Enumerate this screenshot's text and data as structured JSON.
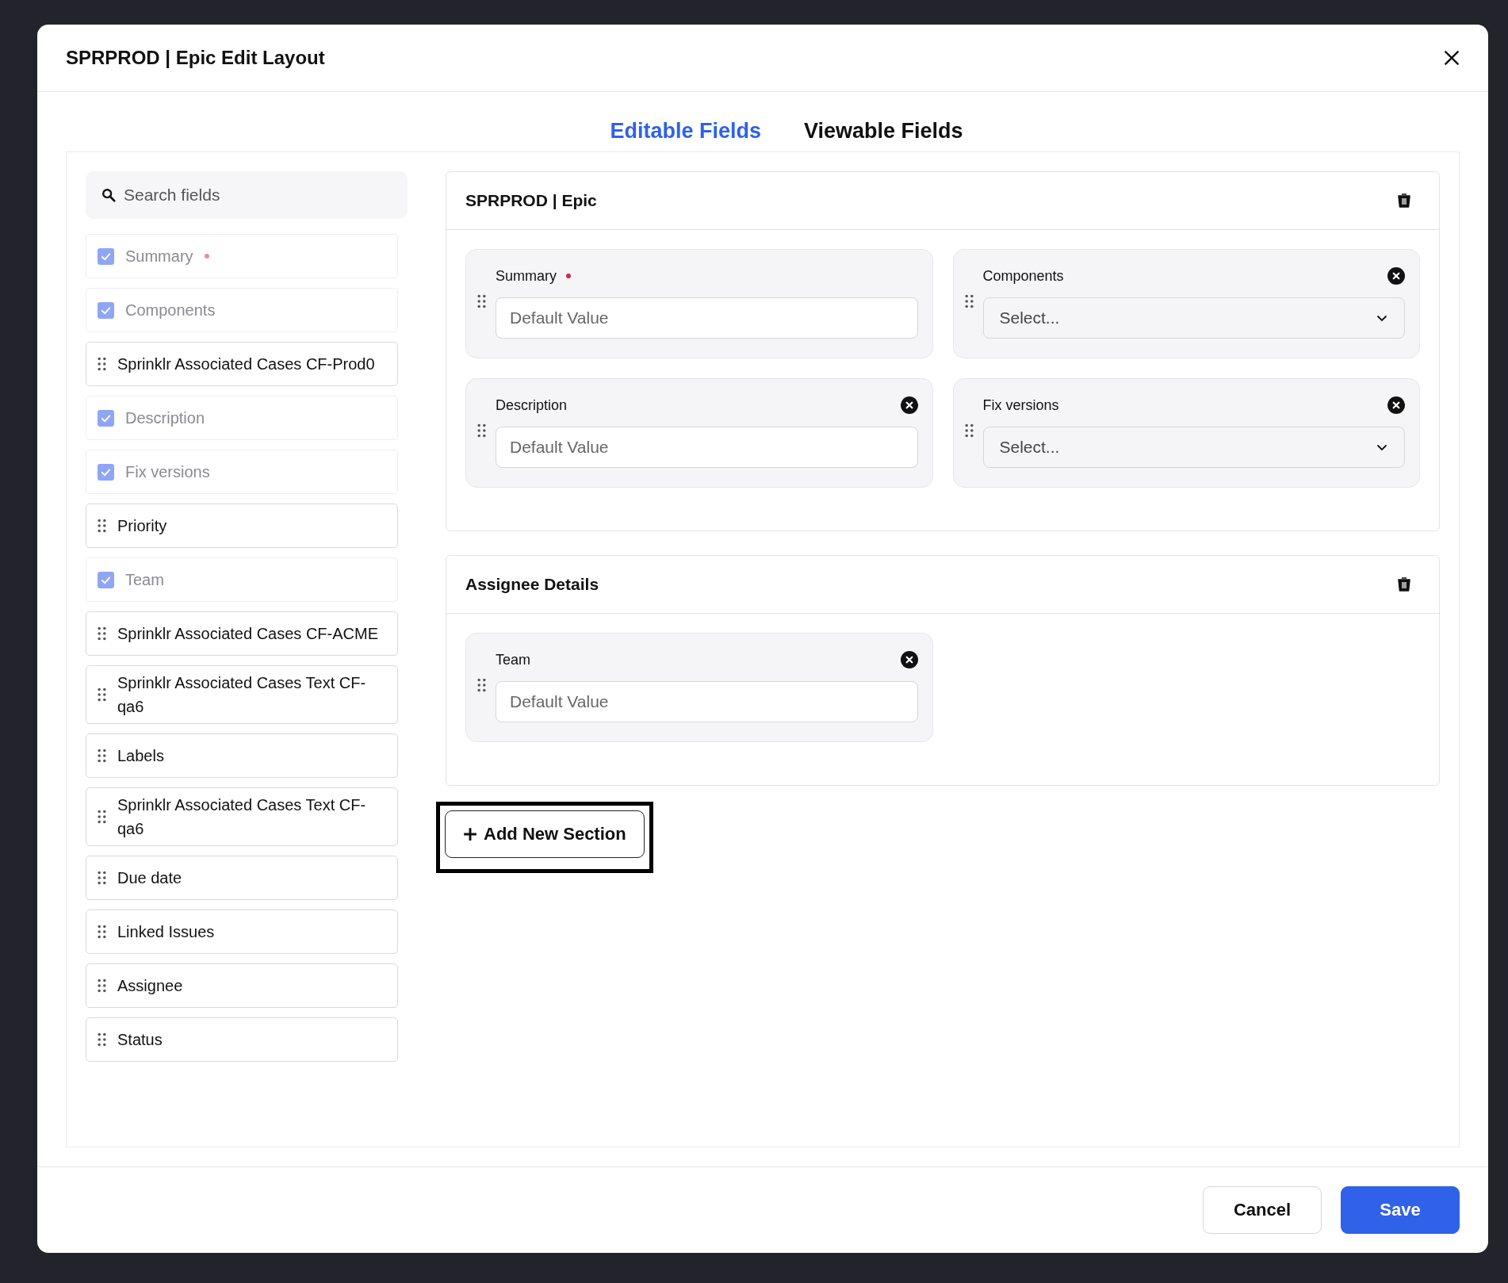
{
  "dialog": {
    "title": "SPRPROD | Epic Edit Layout"
  },
  "tabs": [
    {
      "label": "Editable Fields",
      "selected": true
    },
    {
      "label": "Viewable Fields",
      "selected": false
    }
  ],
  "search": {
    "placeholder": "Search fields"
  },
  "field_list": [
    {
      "kind": "checked",
      "label": "Summary",
      "required": true
    },
    {
      "kind": "checked",
      "label": "Components",
      "required": false
    },
    {
      "kind": "drag",
      "label": "Sprinklr Associated Cases CF-Prod0",
      "required": false
    },
    {
      "kind": "checked",
      "label": "Description",
      "required": false
    },
    {
      "kind": "checked",
      "label": "Fix versions",
      "required": false
    },
    {
      "kind": "drag",
      "label": "Priority",
      "required": false
    },
    {
      "kind": "checked",
      "label": "Team",
      "required": false
    },
    {
      "kind": "drag",
      "label": "Sprinklr Associated Cases CF-ACME",
      "required": false
    },
    {
      "kind": "drag",
      "label": "Sprinklr Associated Cases Text CF-qa6",
      "required": false
    },
    {
      "kind": "drag",
      "label": "Labels",
      "required": false
    },
    {
      "kind": "drag",
      "label": "Sprinklr Associated Cases Text CF-qa6",
      "required": false
    },
    {
      "kind": "drag",
      "label": "Due date",
      "required": false
    },
    {
      "kind": "drag",
      "label": "Linked Issues",
      "required": false
    },
    {
      "kind": "drag",
      "label": "Assignee",
      "required": false
    },
    {
      "kind": "drag",
      "label": "Status",
      "required": false
    }
  ],
  "sections": [
    {
      "title": "SPRPROD | Epic",
      "fields": [
        {
          "label": "Summary",
          "required": true,
          "removable": false,
          "kind": "text",
          "placeholder": "Default Value"
        },
        {
          "label": "Components",
          "required": false,
          "removable": true,
          "kind": "select",
          "placeholder": "Select..."
        },
        {
          "label": "Description",
          "required": false,
          "removable": true,
          "kind": "text",
          "placeholder": "Default Value"
        },
        {
          "label": "Fix versions",
          "required": false,
          "removable": true,
          "kind": "select",
          "placeholder": "Select..."
        }
      ]
    },
    {
      "title": "Assignee Details",
      "fields": [
        {
          "label": "Team",
          "required": false,
          "removable": true,
          "kind": "text",
          "placeholder": "Default Value"
        }
      ]
    }
  ],
  "add_section": {
    "label": "Add New Section",
    "highlighted": true
  },
  "buttons": [
    {
      "label": "Cancel",
      "kind": "secondary"
    },
    {
      "label": "Save",
      "kind": "primary"
    }
  ]
}
